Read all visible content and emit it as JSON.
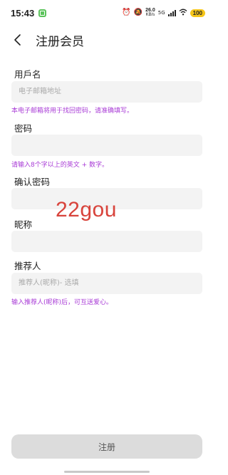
{
  "status_bar": {
    "time": "15:43",
    "speed_value": "26.0",
    "speed_unit": "KB/s",
    "network": "5G",
    "battery": "100"
  },
  "header": {
    "title": "注册会员"
  },
  "form": {
    "username_label": "用戶名",
    "username_placeholder": "电子邮箱地址",
    "username_hint": "本电子邮箱将用于找回密码，请准确填写。",
    "password_label": "密码",
    "password_hint": "请输入8个字以上的英文 + 数字。",
    "confirm_label": "确认密码",
    "nickname_label": "昵称",
    "referrer_label": "推荐人",
    "referrer_placeholder": "推荐人(昵称)- 选填",
    "referrer_hint": "输入推荐人(昵称)后，可互送爱心。"
  },
  "watermark": "22gou",
  "submit_label": "注册"
}
